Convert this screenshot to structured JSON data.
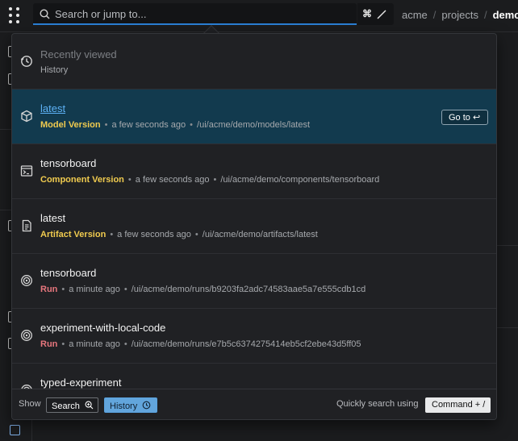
{
  "topbar": {
    "search_placeholder": "Search or jump to...",
    "shortcut_symbol": "⌘",
    "breadcrumb": [
      "acme",
      "projects",
      "demo"
    ]
  },
  "dropdown": {
    "section": {
      "title": "Recently viewed",
      "subtitle": "History"
    },
    "results": [
      {
        "icon": "model-cube-icon",
        "name": "latest",
        "kind": "Model Version",
        "time": "a few seconds ago",
        "path": "/ui/acme/demo/models/latest",
        "active": true,
        "goto_label": "Go to ↩"
      },
      {
        "icon": "terminal-component-icon",
        "name": "tensorboard",
        "kind": "Component Version",
        "time": "a few seconds ago",
        "path": "/ui/acme/demo/components/tensorboard"
      },
      {
        "icon": "artifact-file-icon",
        "name": "latest",
        "kind": "Artifact Version",
        "time": "a few seconds ago",
        "path": "/ui/acme/demo/artifacts/latest"
      },
      {
        "icon": "run-target-icon",
        "name": "tensorboard",
        "kind": "Run",
        "time": "a minute ago",
        "path": "/ui/acme/demo/runs/b9203fa2adc74583aae5a7e555cdb1cd"
      },
      {
        "icon": "run-target-icon",
        "name": "experiment-with-local-code",
        "kind": "Run",
        "time": "a minute ago",
        "path": "/ui/acme/demo/runs/e7b5c6374275414eb5cf2ebe43d5ff05"
      },
      {
        "icon": "run-target-icon",
        "name": "typed-experiment"
      }
    ],
    "footer": {
      "show_label": "Show",
      "search_chip": "Search",
      "history_chip": "History",
      "quick_label": "Quickly search using",
      "shortcut": "Command + /"
    }
  },
  "colors": {
    "accent": "#2a7fd4",
    "active_row": "#123a4e",
    "kind_version": "#f0cb4f",
    "kind_run": "#e6767d"
  }
}
